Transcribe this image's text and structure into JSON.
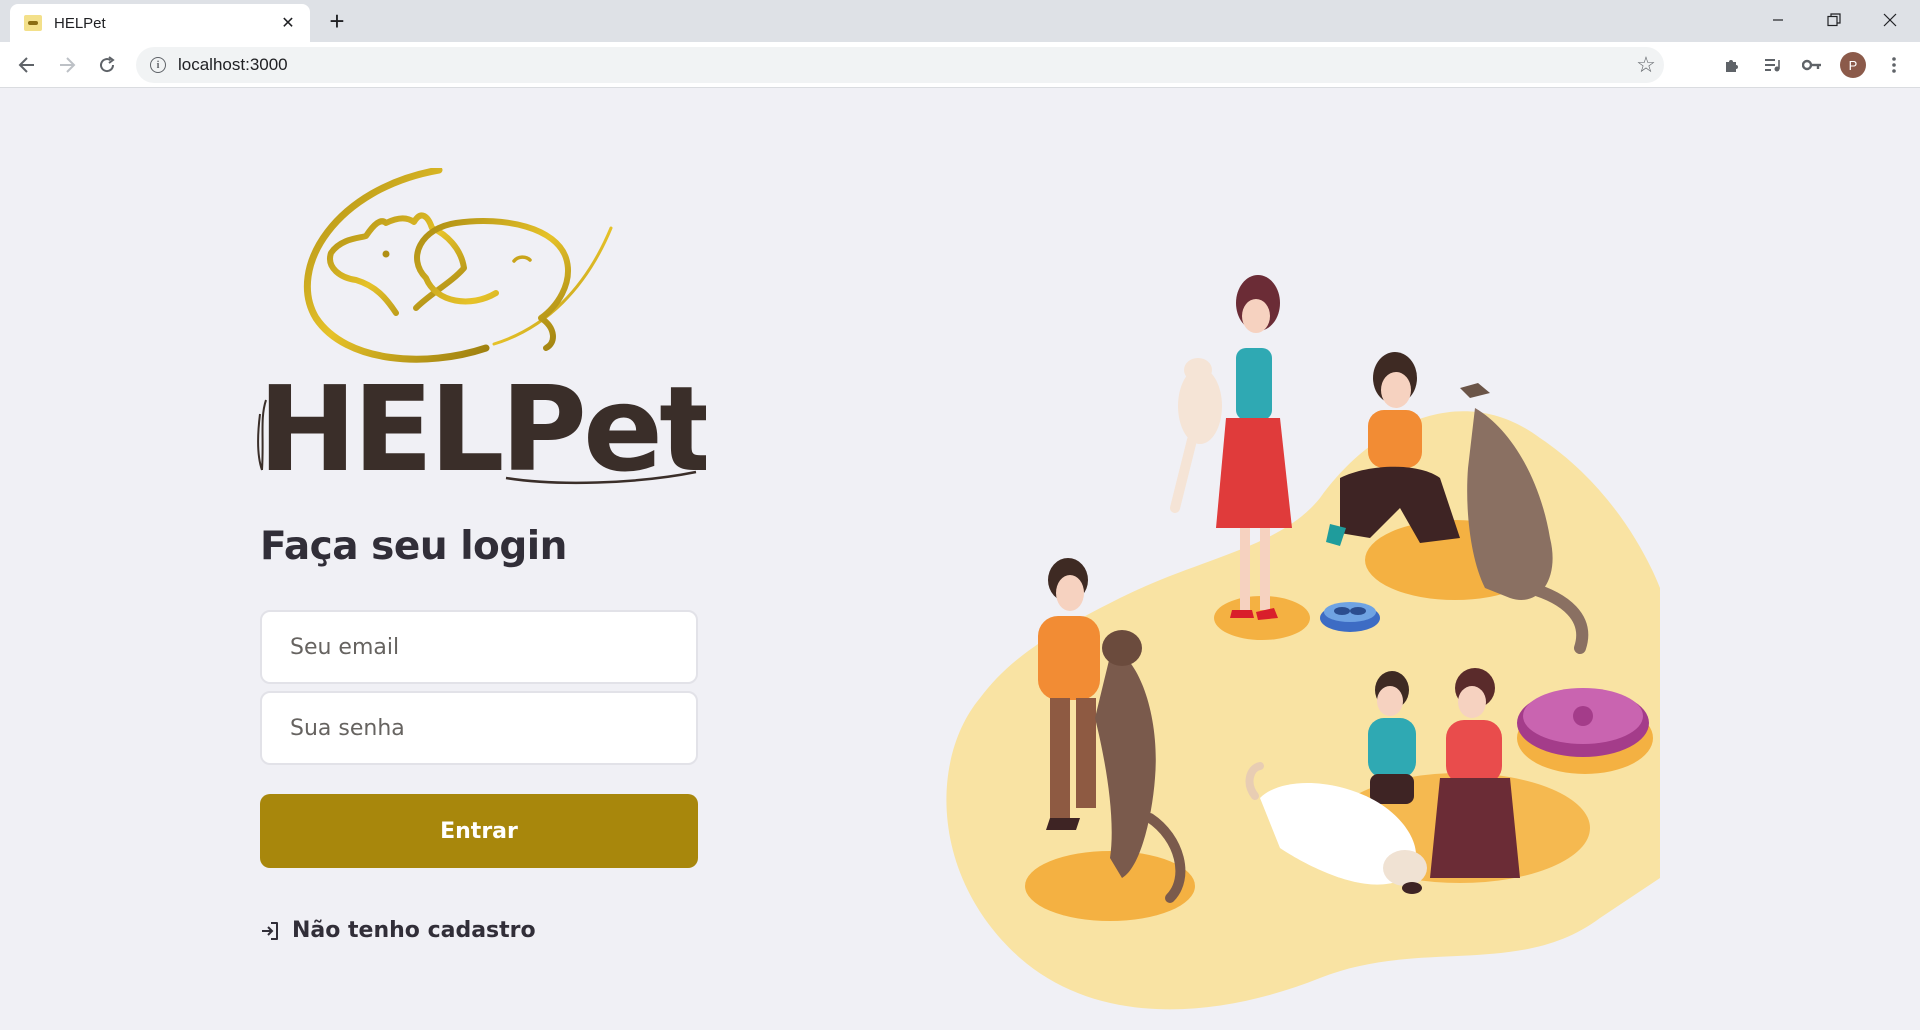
{
  "browser": {
    "tab_title": "HELPet",
    "new_tab_symbol": "+",
    "url": "localhost:3000",
    "profile_initial": "P"
  },
  "login": {
    "logo_text": "HELPet",
    "title": "Faça seu login",
    "email_placeholder": "Seu email",
    "password_placeholder": "Sua senha",
    "submit_label": "Entrar",
    "register_label": "Não tenho cadastro"
  },
  "icons": {
    "back": "arrow-left-icon",
    "forward": "arrow-right-icon",
    "reload": "reload-icon",
    "register": "log-in-icon"
  },
  "colors": {
    "accent": "#a8870c",
    "background": "#f0f0f5",
    "text": "#312e38",
    "illustration_blob": "#f9e3a3"
  }
}
